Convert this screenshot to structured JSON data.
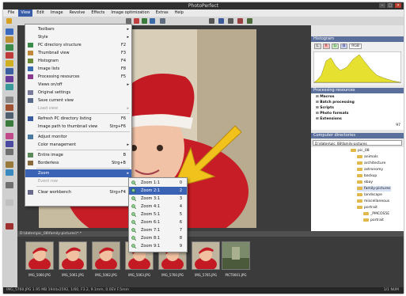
{
  "app": {
    "title": "PhotoPerfect"
  },
  "menubar": [
    "File",
    "View",
    "Edit",
    "Image",
    "Revolve",
    "Effects",
    "Image optimization",
    "Extras",
    "Help"
  ],
  "view_menu": {
    "items": [
      {
        "label": "Toolbars",
        "shortcut": "",
        "submenu": true,
        "disabled": false
      },
      {
        "label": "Style",
        "shortcut": "",
        "submenu": true,
        "disabled": false
      },
      {
        "label": "PC directory structure",
        "shortcut": "F2",
        "submenu": false,
        "disabled": false
      },
      {
        "label": "Thumbnail view",
        "shortcut": "F3",
        "submenu": false,
        "disabled": false
      },
      {
        "label": "Histogram",
        "shortcut": "F4",
        "submenu": false,
        "disabled": false
      },
      {
        "label": "Image lists",
        "shortcut": "F8",
        "submenu": false,
        "disabled": false
      },
      {
        "label": "Processing resources",
        "shortcut": "F5",
        "submenu": false,
        "disabled": false
      },
      {
        "label": "Views on/off",
        "shortcut": "",
        "submenu": true,
        "disabled": false
      },
      {
        "label": "Original settings",
        "shortcut": "",
        "submenu": false,
        "disabled": false
      },
      {
        "label": "Save current view",
        "shortcut": "",
        "submenu": false,
        "disabled": false
      },
      {
        "label": "Load view",
        "shortcut": "",
        "submenu": true,
        "disabled": true
      },
      {
        "label": "Refresh PC directory listing",
        "shortcut": "F6",
        "submenu": false,
        "disabled": false
      },
      {
        "label": "Image path to thumbnail view",
        "shortcut": "Strg+F6",
        "submenu": false,
        "disabled": false
      },
      {
        "label": "Adjust monitor",
        "shortcut": "",
        "submenu": false,
        "disabled": false
      },
      {
        "label": "Color management",
        "shortcut": "",
        "submenu": true,
        "disabled": false
      },
      {
        "label": "Entire image",
        "shortcut": "B",
        "submenu": false,
        "disabled": false
      },
      {
        "label": "Borderless",
        "shortcut": "Strg+B",
        "submenu": false,
        "disabled": false
      },
      {
        "label": "Zoom",
        "shortcut": "",
        "submenu": true,
        "disabled": false,
        "highlighted": true
      },
      {
        "label": "Event row",
        "shortcut": "",
        "submenu": false,
        "disabled": true
      },
      {
        "label": "Clear workbench",
        "shortcut": "Strg+F4",
        "submenu": false,
        "disabled": false
      }
    ]
  },
  "zoom_menu": {
    "items": [
      {
        "label": "Zoom 1:1",
        "shortcut": "0"
      },
      {
        "label": "Zoom 2:1",
        "shortcut": "2",
        "highlighted": true
      },
      {
        "label": "Zoom 3:1",
        "shortcut": "3"
      },
      {
        "label": "Zoom 4:1",
        "shortcut": "4"
      },
      {
        "label": "Zoom 5:1",
        "shortcut": "5"
      },
      {
        "label": "Zoom 6:1",
        "shortcut": "6"
      },
      {
        "label": "Zoom 7:1",
        "shortcut": "7"
      },
      {
        "label": "Zoom 8:1",
        "shortcut": "8"
      },
      {
        "label": "Zoom 9:1",
        "shortcut": "9"
      }
    ]
  },
  "panels": {
    "histogram": {
      "title": "Histogram",
      "channels": [
        "L",
        "R",
        "G",
        "B",
        "RGB"
      ]
    },
    "processing": {
      "title": "Processing resources",
      "items": [
        "Macros",
        "Batch processing",
        "Scripts",
        "Photo formats",
        "Extensions"
      ],
      "counter": "97"
    },
    "directory": {
      "title": "Computer directories",
      "path": "D:\\daten\\pic_08\\family-pictures",
      "folders": [
        "pic_08",
        "animals",
        "architecture",
        "astronomy",
        "backup",
        "ebay",
        "family-pictures",
        "landscape",
        "miscellaneous",
        "portrait",
        "_PMCOS5E",
        "portrait"
      ]
    }
  },
  "thumbnails": {
    "header": "D:\\daten\\pic_08\\family-pictures\\*.*",
    "items": [
      "IMG_5060.JPG",
      "IMG_5061.JPG",
      "IMG_5062.JPG",
      "IMG_5063.JPG",
      "IMG_5760.JPG",
      "IMG_5765.JPG",
      "PICT0001.JPG"
    ]
  },
  "status": {
    "left": "IMG_5760.JPG  1.95 MB  1944x2592, 1/60, F3.2, 9.1mm, 0.0EV  F.5mm",
    "right": "1/1  NUM"
  }
}
